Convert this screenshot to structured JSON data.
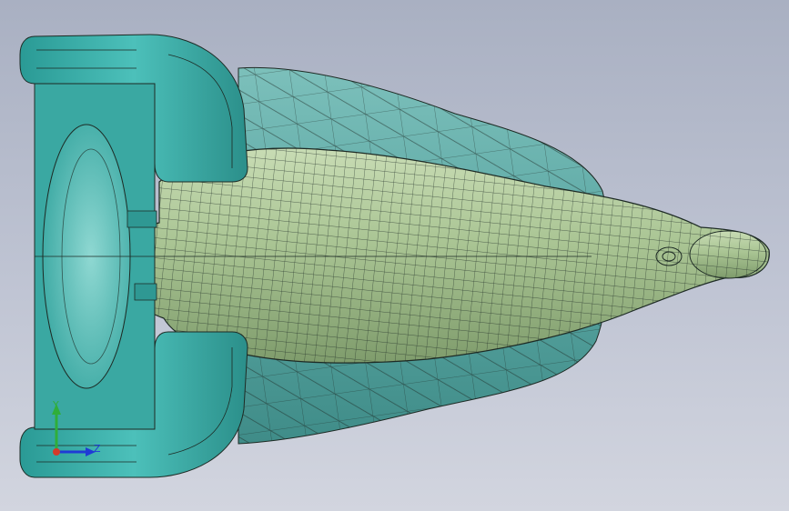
{
  "viewport": {
    "background_top": "#a9b0c2",
    "background_bottom": "#d2d5df",
    "model": {
      "base_color": "#3fb3ad",
      "base_shadow": "#1f7f7b",
      "body_color": "#a9c493",
      "body_shadow": "#7f9c6c",
      "shell_color": "#5aa6a2",
      "mesh_color": "#1d2a24"
    },
    "triad": {
      "y_label": "Y",
      "z_label": "Z",
      "y_color": "#2fae3a",
      "z_color": "#1f3bd6",
      "origin_color": "#d23a2a"
    }
  }
}
